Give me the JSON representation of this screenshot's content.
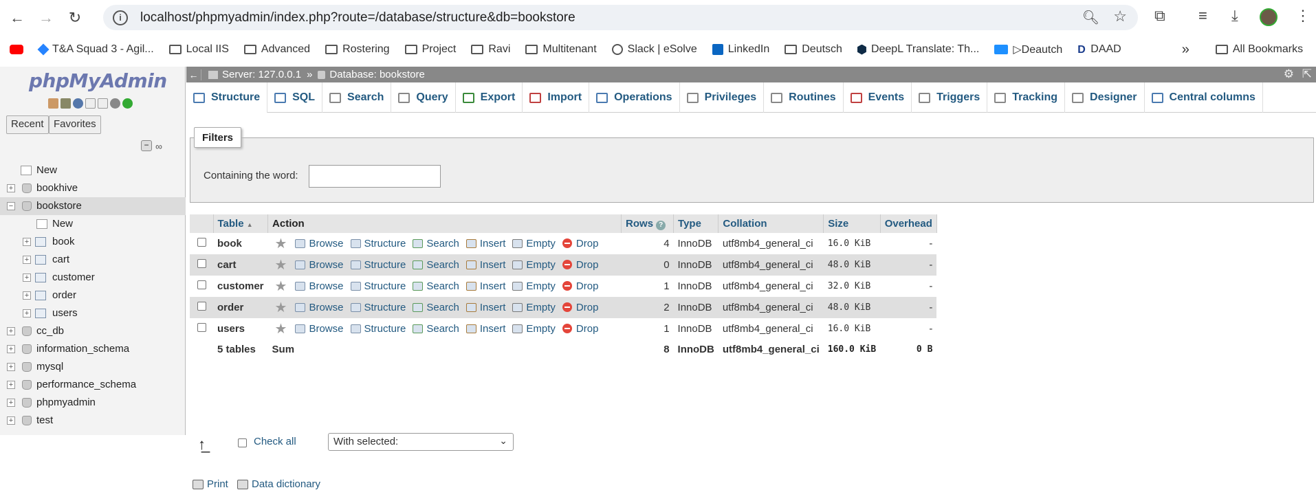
{
  "browser": {
    "url": "localhost/phpmyadmin/index.php?route=/database/structure&db=bookstore",
    "bookmarks": [
      {
        "label": "T&A Squad 3 - Agil...",
        "icon": "jira-icon",
        "color": "#2684ff"
      },
      {
        "label": "Local IIS",
        "icon": "folder-icon"
      },
      {
        "label": "Advanced",
        "icon": "folder-icon"
      },
      {
        "label": "Rostering",
        "icon": "folder-icon"
      },
      {
        "label": "Project",
        "icon": "folder-icon"
      },
      {
        "label": "Ravi",
        "icon": "folder-icon"
      },
      {
        "label": "Multitenant",
        "icon": "folder-icon"
      },
      {
        "label": "Slack | eSolve",
        "icon": "globe-icon"
      },
      {
        "label": "LinkedIn",
        "icon": "linkedin-icon",
        "color": "#0a66c2"
      },
      {
        "label": "Deutsch",
        "icon": "folder-icon"
      },
      {
        "label": "DeepL Translate: Th...",
        "icon": "deepl-icon",
        "color": "#0f2b46"
      },
      {
        "label": "▷Deautch",
        "icon": "bookmark-icon",
        "color": "#1e90ff"
      },
      {
        "label": "DAAD",
        "icon": "daad-icon",
        "color": "#1a3c8c"
      }
    ],
    "all_bookmarks": "All Bookmarks",
    "more_label": "»"
  },
  "pma": {
    "logo_a": "php",
    "logo_b": "MyAdmin",
    "recent": "Recent",
    "favorites": "Favorites",
    "tree": [
      {
        "label": "New",
        "level": 1,
        "kind": "new"
      },
      {
        "label": "bookhive",
        "level": 0,
        "kind": "db"
      },
      {
        "label": "bookstore",
        "level": 0,
        "kind": "db",
        "selected": true
      },
      {
        "label": "New",
        "level": 2,
        "kind": "new"
      },
      {
        "label": "book",
        "level": 2,
        "kind": "table"
      },
      {
        "label": "cart",
        "level": 2,
        "kind": "table"
      },
      {
        "label": "customer",
        "level": 2,
        "kind": "table"
      },
      {
        "label": "order",
        "level": 2,
        "kind": "table"
      },
      {
        "label": "users",
        "level": 2,
        "kind": "table"
      },
      {
        "label": "cc_db",
        "level": 0,
        "kind": "db"
      },
      {
        "label": "information_schema",
        "level": 0,
        "kind": "db"
      },
      {
        "label": "mysql",
        "level": 0,
        "kind": "db"
      },
      {
        "label": "performance_schema",
        "level": 0,
        "kind": "db"
      },
      {
        "label": "phpmyadmin",
        "level": 0,
        "kind": "db"
      },
      {
        "label": "test",
        "level": 0,
        "kind": "db"
      }
    ],
    "breadcrumb": {
      "server": "Server: 127.0.0.1",
      "sep": "»",
      "database": "Database: bookstore"
    },
    "tabs": [
      "Structure",
      "SQL",
      "Search",
      "Query",
      "Export",
      "Import",
      "Operations",
      "Privileges",
      "Routines",
      "Events",
      "Triggers",
      "Tracking",
      "Designer",
      "Central columns"
    ],
    "filters": {
      "legend": "Filters",
      "label": "Containing the word:",
      "value": ""
    },
    "table_headers": {
      "table": "Table",
      "sort": "▲",
      "action": "Action",
      "rows": "Rows",
      "type": "Type",
      "collation": "Collation",
      "size": "Size",
      "overhead": "Overhead"
    },
    "actions": [
      "Browse",
      "Structure",
      "Search",
      "Insert",
      "Empty",
      "Drop"
    ],
    "rows": [
      {
        "name": "book",
        "rows": "4",
        "type": "InnoDB",
        "collation": "utf8mb4_general_ci",
        "size": "16.0 KiB",
        "overhead": "-"
      },
      {
        "name": "cart",
        "rows": "0",
        "type": "InnoDB",
        "collation": "utf8mb4_general_ci",
        "size": "48.0 KiB",
        "overhead": "-"
      },
      {
        "name": "customer",
        "rows": "1",
        "type": "InnoDB",
        "collation": "utf8mb4_general_ci",
        "size": "32.0 KiB",
        "overhead": "-"
      },
      {
        "name": "order",
        "rows": "2",
        "type": "InnoDB",
        "collation": "utf8mb4_general_ci",
        "size": "48.0 KiB",
        "overhead": "-"
      },
      {
        "name": "users",
        "rows": "1",
        "type": "InnoDB",
        "collation": "utf8mb4_general_ci",
        "size": "16.0 KiB",
        "overhead": "-"
      }
    ],
    "summary": {
      "tables": "5 tables",
      "sum": "Sum",
      "rows": "8",
      "type": "InnoDB",
      "collation": "utf8mb4_general_ci",
      "size": "160.0 KiB",
      "overhead": "0 B"
    },
    "check_all": "Check all",
    "with_selected": "With selected:",
    "print": "Print",
    "data_dictionary": "Data dictionary"
  }
}
